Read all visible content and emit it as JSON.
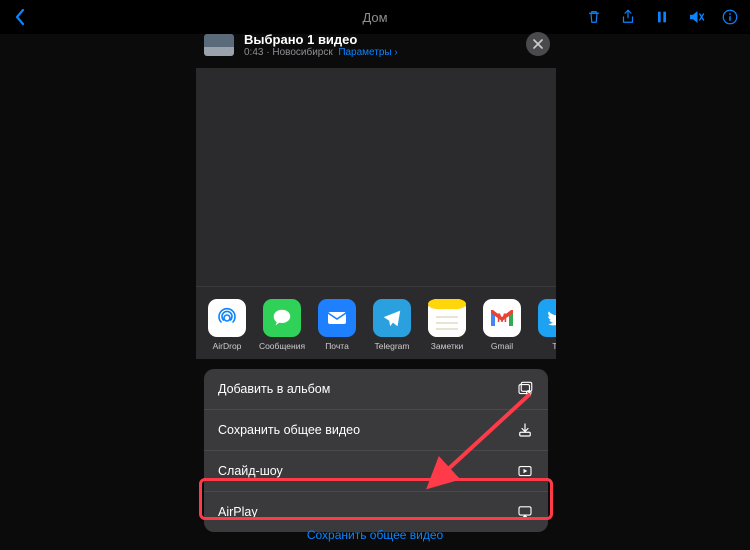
{
  "nav": {
    "title": "Дом"
  },
  "sheet": {
    "title": "Выбрано 1 видео",
    "duration": "0:43",
    "location": "Новосибирск",
    "options_link": "Параметры"
  },
  "apps": [
    {
      "name": "AirDrop",
      "bg": "#ffffff",
      "icon": "airdrop"
    },
    {
      "name": "Сообщения",
      "bg": "#30d158",
      "icon": "message"
    },
    {
      "name": "Почта",
      "bg": "#1e80ff",
      "icon": "mail"
    },
    {
      "name": "Telegram",
      "bg": "#2aa1de",
      "icon": "telegram"
    },
    {
      "name": "Заметки",
      "bg": "#ffd60a",
      "icon": "notes"
    },
    {
      "name": "Gmail",
      "bg": "#ffffff",
      "icon": "gmail"
    },
    {
      "name": "Tv",
      "bg": "#1da1f2",
      "icon": "twitter"
    }
  ],
  "actions": [
    {
      "label": "Добавить в альбом",
      "icon": "album"
    },
    {
      "label": "Сохранить общее видео",
      "icon": "save"
    },
    {
      "label": "Слайд-шоу",
      "icon": "slideshow"
    },
    {
      "label": "AirPlay",
      "icon": "airplay"
    }
  ],
  "bottom_link": "Сохранить общее видео"
}
